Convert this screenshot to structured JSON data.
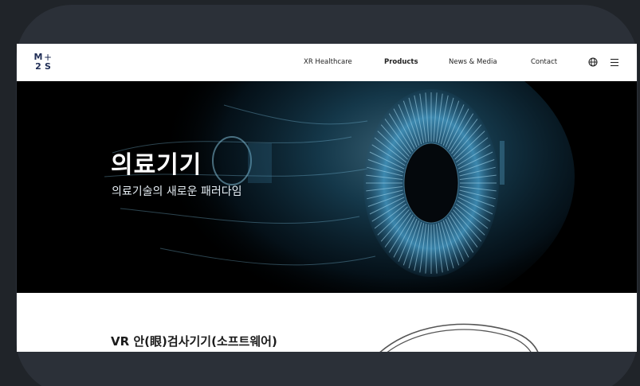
{
  "header": {
    "logo": {
      "top_left": "M",
      "top_right": "+",
      "bottom_left": "2",
      "bottom_right": "S"
    },
    "nav": [
      {
        "label": "XR Healthcare",
        "active": false
      },
      {
        "label": "Products",
        "active": true
      },
      {
        "label": "News & Media",
        "active": false
      },
      {
        "label": "Contact",
        "active": false
      }
    ],
    "icons": {
      "language": "globe-icon",
      "menu": "hamburger-menu-icon"
    }
  },
  "hero": {
    "title": "의료기기",
    "subtitle": "의료기술의 새로운 패러다임"
  },
  "product": {
    "title": "VR 안(眼)검사기기(소프트웨어)"
  },
  "colors": {
    "page_background": "#202429",
    "frame": "#2b3038",
    "logo": "#1f2d55",
    "hero_background": "#000000",
    "hero_glow": "#3f8fb8"
  }
}
